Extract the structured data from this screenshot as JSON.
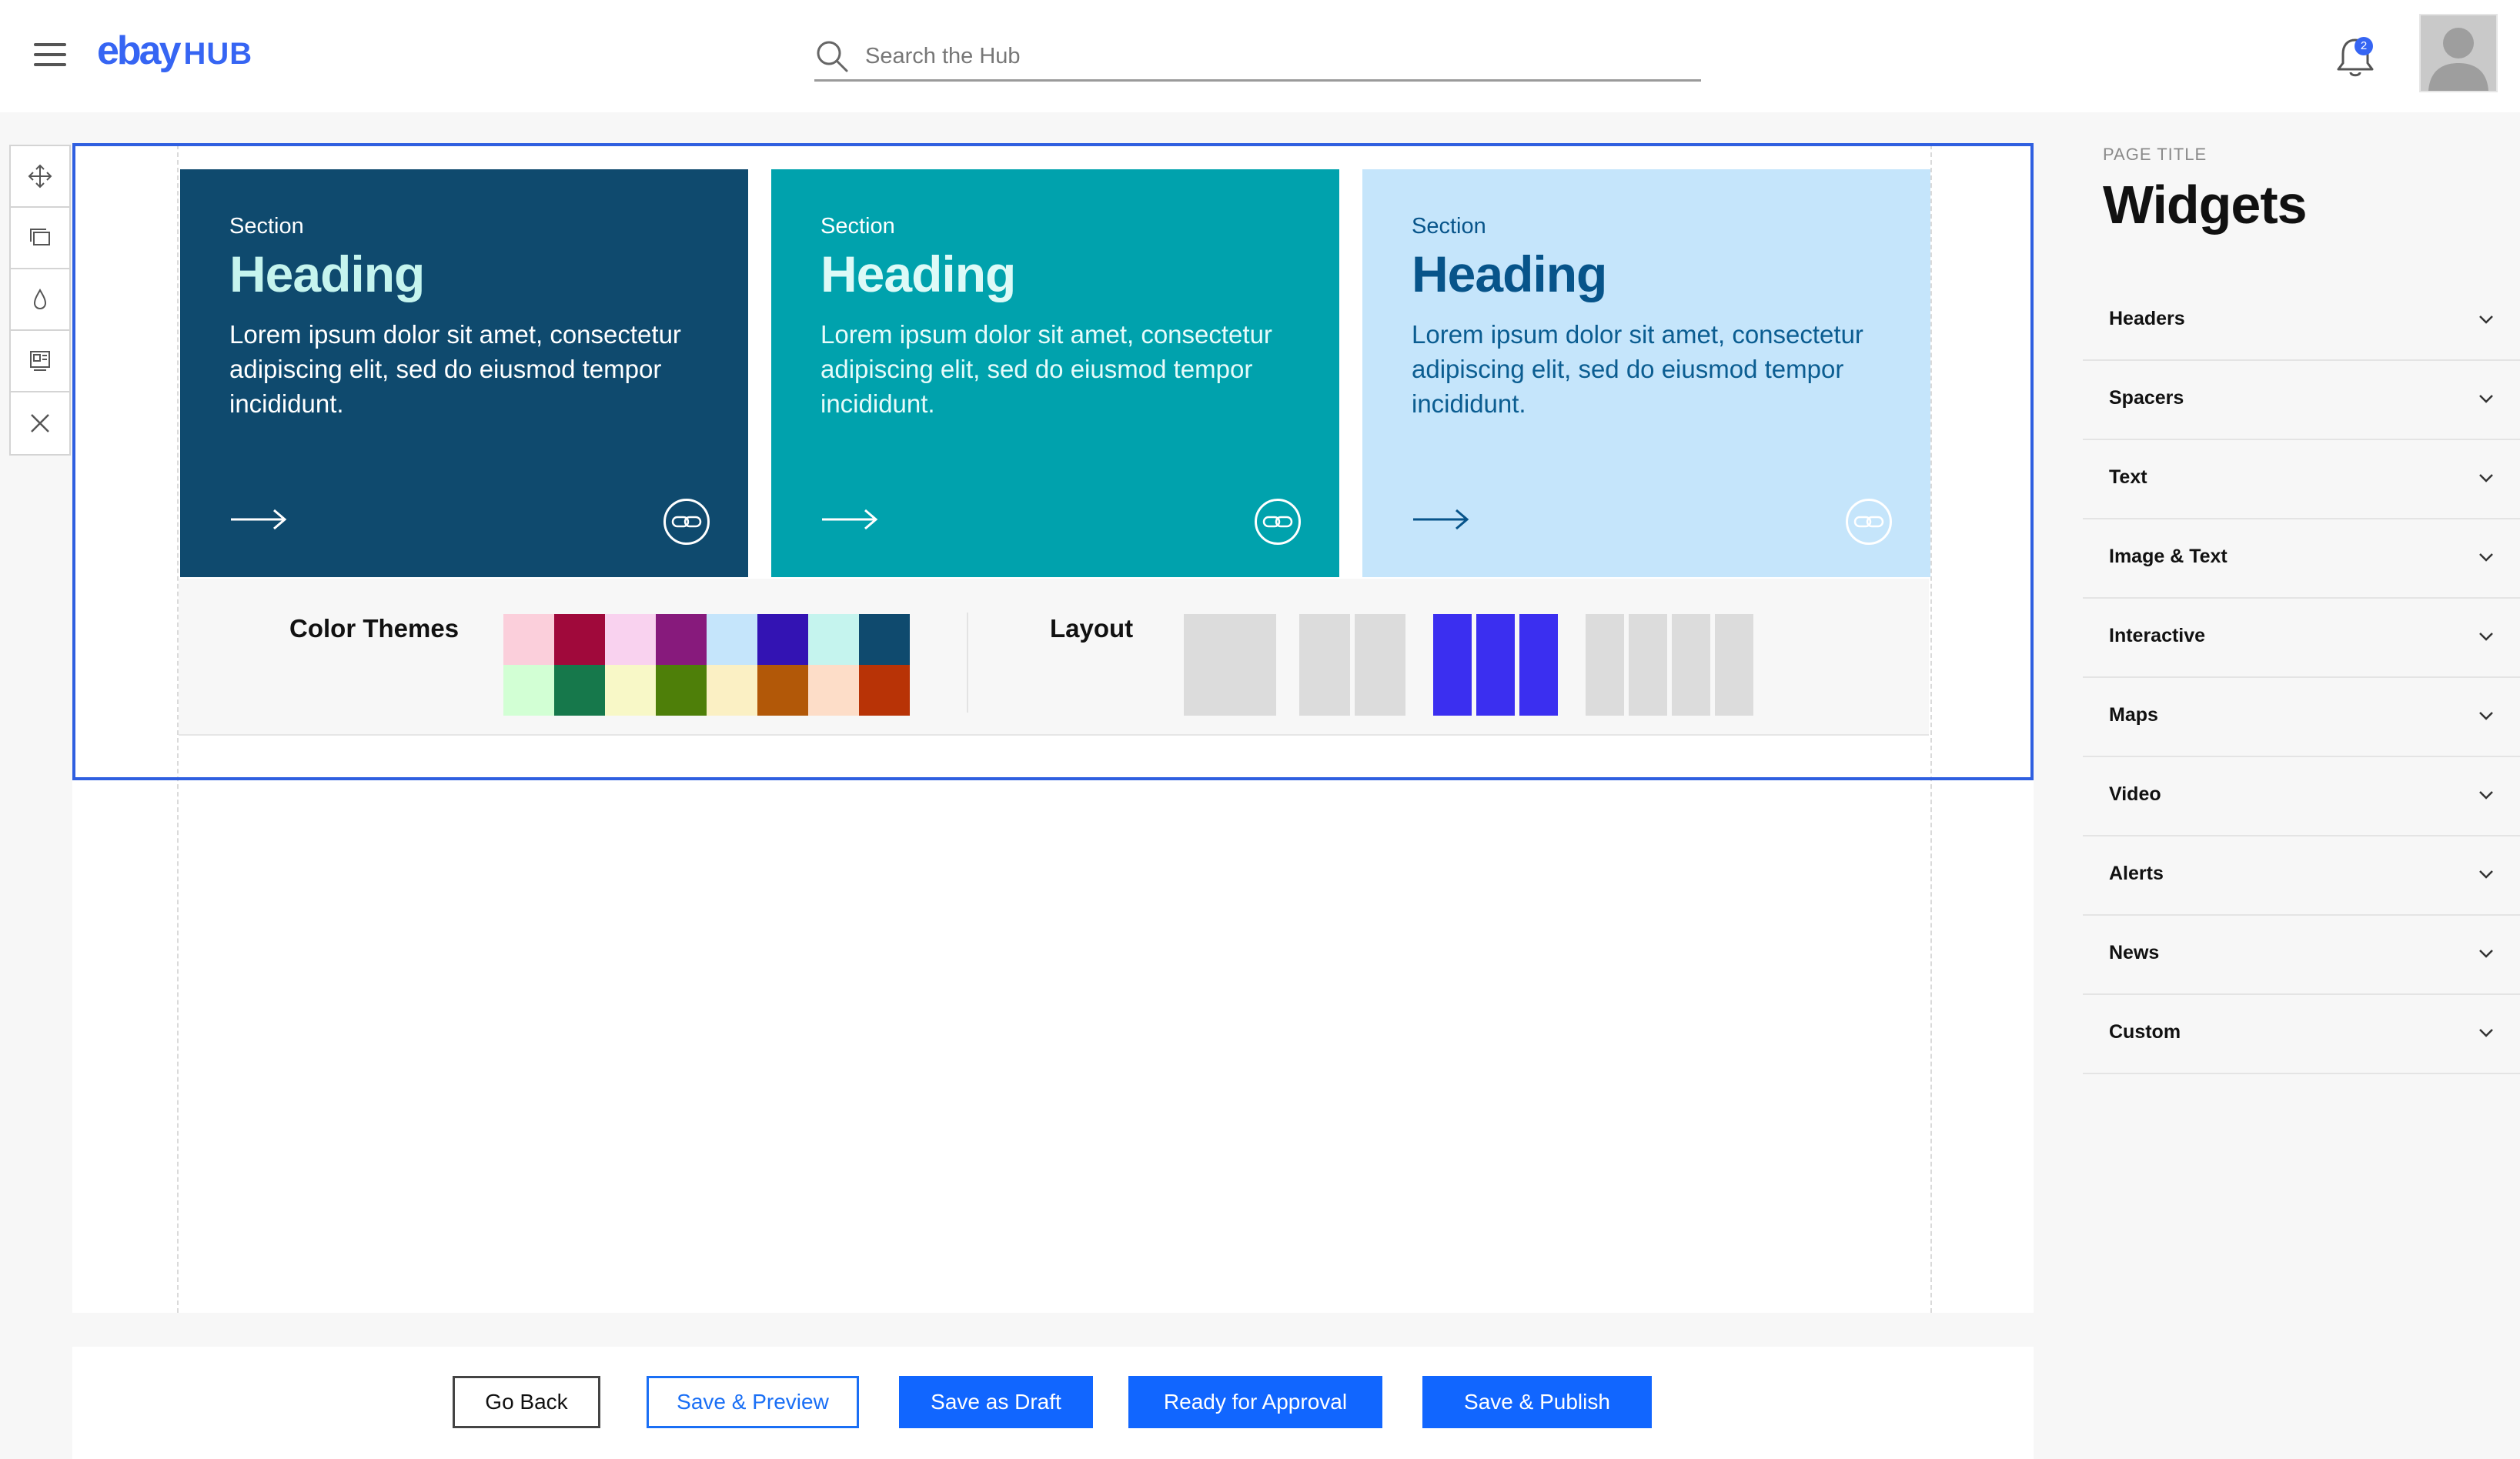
{
  "header": {
    "logo_ebay": "ebay",
    "logo_hub": "HUB",
    "search_placeholder": "Search the Hub",
    "notification_count": "2"
  },
  "tools": [
    "move-icon",
    "duplicate-icon",
    "color-drop-icon",
    "layout-icon",
    "close-icon"
  ],
  "cards": [
    {
      "section": "Section",
      "heading": "Heading",
      "body": "Lorem ipsum dolor sit amet, consectetur adipiscing elit, sed do eiusmod tempor incididunt."
    },
    {
      "section": "Section",
      "heading": "Heading",
      "body": "Lorem ipsum dolor sit amet, consectetur adipiscing elit, sed do eiusmod tempor incididunt."
    },
    {
      "section": "Section",
      "heading": "Heading",
      "body": "Lorem ipsum dolor sit amet, consectetur adipiscing elit, sed do eiusmod tempor incididunt."
    }
  ],
  "options": {
    "color_themes_label": "Color Themes",
    "layout_label": "Layout",
    "swatches": [
      "#fbcfdb",
      "#a0093b",
      "#f9d2ef",
      "#871a7c",
      "#c5e5fb",
      "#3313b3",
      "#c5f4ee",
      "#0f4a6e",
      "#d2ffd4",
      "#16784b",
      "#f8f8c7",
      "#4e7f09",
      "#fbf0c4",
      "#b25808",
      "#fdddc8",
      "#b83306"
    ],
    "layout_accent": "#3b2ff0",
    "layout_neutral": "#dcdcdc"
  },
  "footer": {
    "go_back": "Go Back",
    "save_preview": "Save & Preview",
    "save_draft": "Save as Draft",
    "ready_approval": "Ready for Approval",
    "save_publish": "Save & Publish"
  },
  "panel": {
    "eyebrow": "PAGE TITLE",
    "title": "Widgets",
    "items": [
      "Headers",
      "Spacers",
      "Text",
      "Image & Text",
      "Interactive",
      "Maps",
      "Video",
      "Alerts",
      "News",
      "Custom"
    ]
  },
  "colors": {
    "brand": "#3665f3",
    "primary_button": "#1166ff",
    "selection": "#2f5fe0"
  }
}
